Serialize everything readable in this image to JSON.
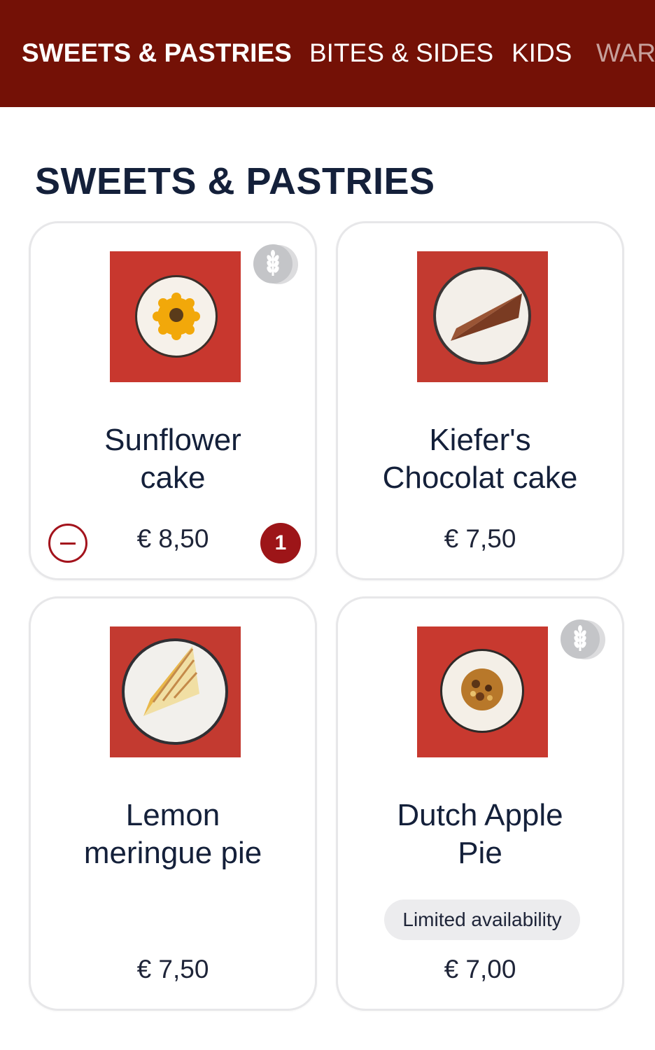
{
  "nav": {
    "tabs": [
      {
        "label": "SWEETS & PASTRIES",
        "active": true
      },
      {
        "label": "BITES & SIDES",
        "active": false
      },
      {
        "label": "KIDS",
        "active": false
      },
      {
        "label": "WAR",
        "active": false
      }
    ]
  },
  "section": {
    "title": "SWEETS & PASTRIES"
  },
  "products": [
    {
      "name_line1": "Sunflower",
      "name_line2": "cake",
      "price": "€ 8,50",
      "quantity": "1",
      "gluten_icon": "wheat-icon"
    },
    {
      "name_line1": "Kiefer's",
      "name_line2": "Chocolat cake",
      "price": "€ 7,50"
    },
    {
      "name_line1": "Lemon",
      "name_line2": "meringue pie",
      "price": "€ 7,50"
    },
    {
      "name_line1": "Dutch Apple",
      "name_line2": "Pie",
      "price": "€ 7,00",
      "badge": "Limited availability",
      "gluten_icon": "wheat-icon"
    }
  ],
  "colors": {
    "header_bg": "#741106",
    "accent_red": "#9d1518",
    "text_navy": "#14203a",
    "photo_red": "#c43a33"
  }
}
